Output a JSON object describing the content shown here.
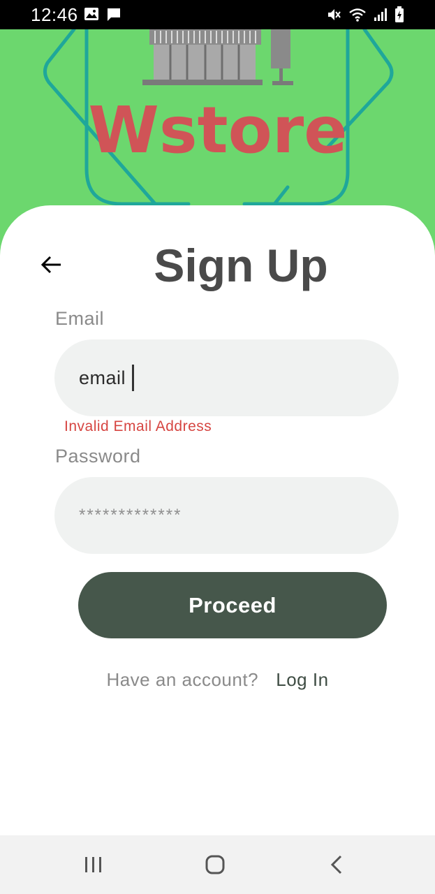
{
  "status_bar": {
    "time": "12:46",
    "left_icons": [
      "image-icon",
      "message-icon"
    ],
    "right_icons": [
      "mute-icon",
      "wifi-icon",
      "signal-icon",
      "battery-charging-icon"
    ]
  },
  "header": {
    "brand": "Wstore",
    "background_color": "#6cd76e",
    "brand_color": "#d05457"
  },
  "signup": {
    "title": "Sign Up",
    "back_icon": "arrow-left-icon",
    "email": {
      "label": "Email",
      "value": "email",
      "error": "Invalid Email Address"
    },
    "password": {
      "label": "Password",
      "value": "*************"
    },
    "proceed_label": "Proceed",
    "account_question": "Have an account?",
    "login_label": "Log In",
    "button_color": "#46574b",
    "error_color": "#d64541"
  },
  "nav_bar": {
    "icons": [
      "recent-apps-icon",
      "home-icon",
      "back-icon"
    ]
  }
}
